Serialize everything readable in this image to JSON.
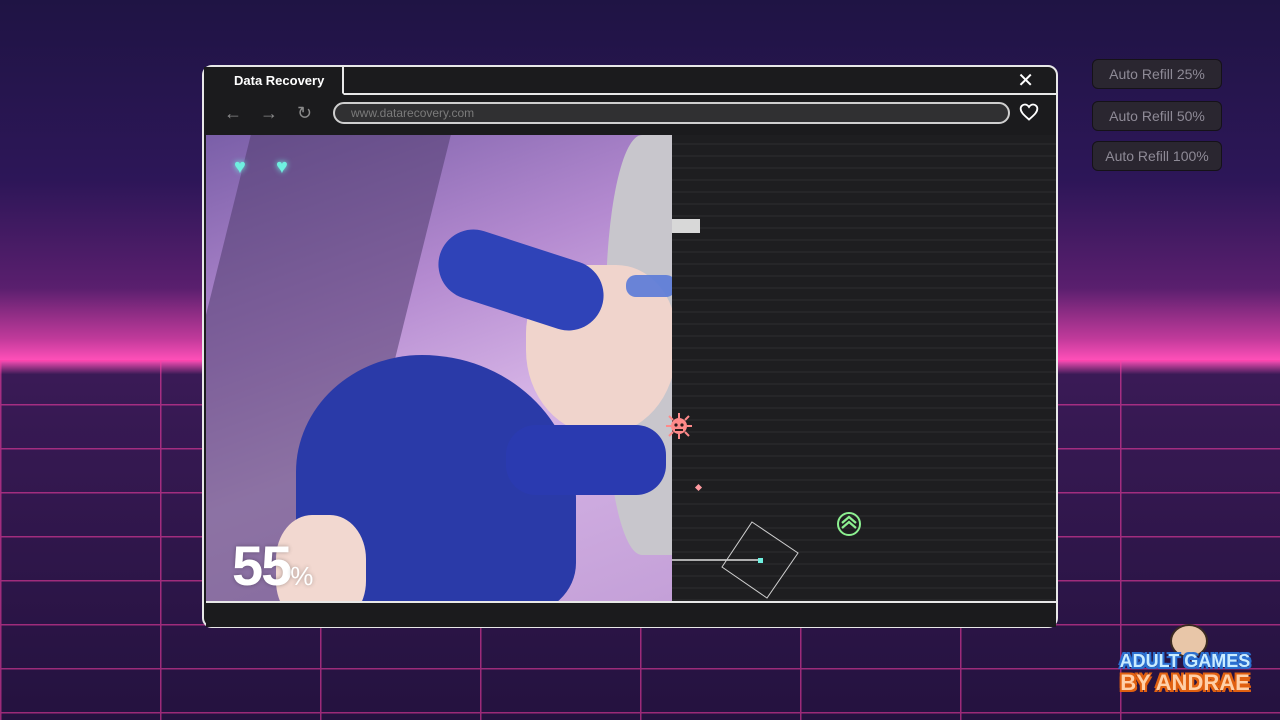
{
  "window": {
    "tab_title": "Data Recovery",
    "url": "www.datarecovery.com",
    "icons": {
      "back": "arrow-left-icon",
      "forward": "arrow-right-icon",
      "reload": "reload-icon",
      "favorite": "heart-icon",
      "close": "close-icon"
    }
  },
  "game": {
    "lives": 2,
    "life_icon": "heart-pixel-icon",
    "progress_value": "55",
    "progress_sign": "%",
    "progress_fraction": 0.55
  },
  "refills": [
    {
      "label": "Auto Refill 25%"
    },
    {
      "label": "Auto Refill 50%"
    },
    {
      "label": "Auto Refill 100%"
    }
  ],
  "watermark": {
    "line1": "ADULT GAMES",
    "line2": "BY ANDRAE"
  },
  "colors": {
    "accent": "#ff3fa8",
    "life": "#6ff0e0",
    "ship": "#8cf090"
  }
}
